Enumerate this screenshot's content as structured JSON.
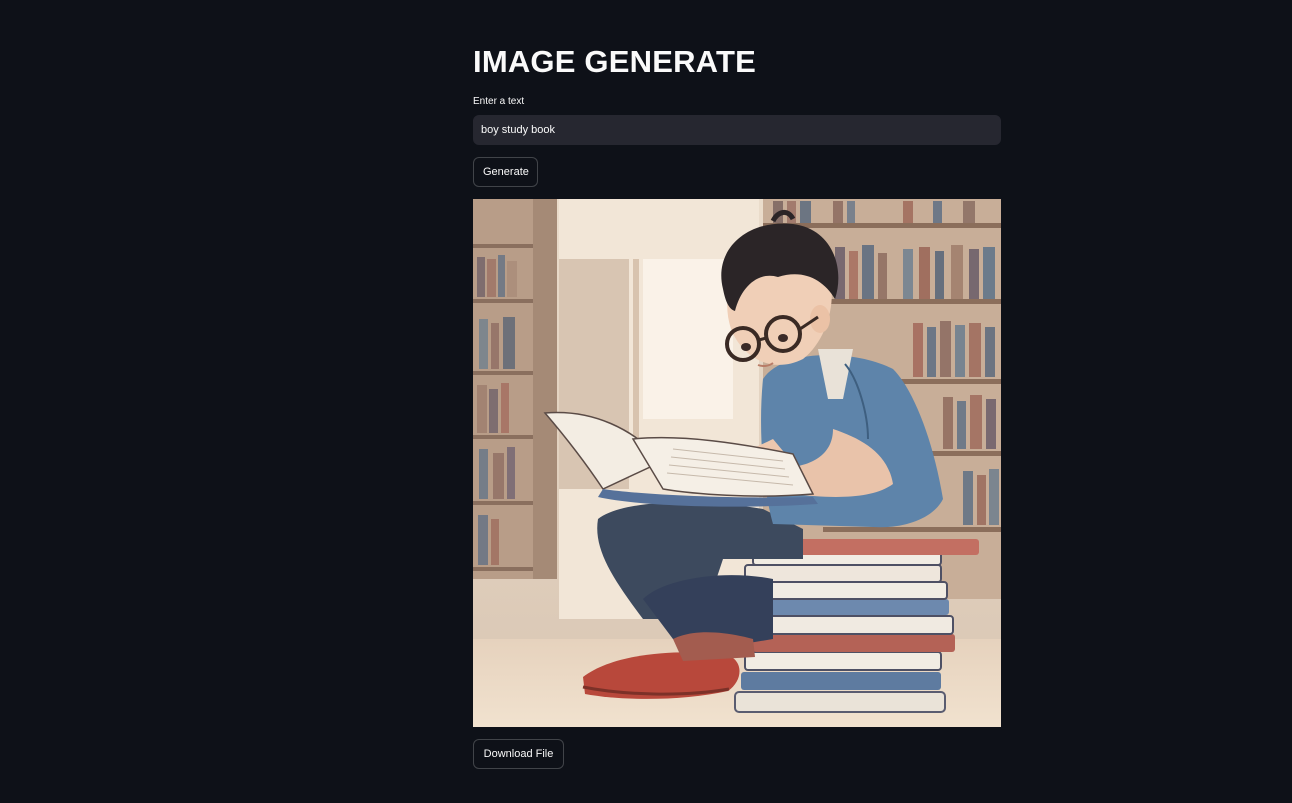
{
  "page": {
    "title": "IMAGE GENERATE"
  },
  "prompt_input": {
    "label": "Enter a text",
    "value": "boy study book"
  },
  "buttons": {
    "generate_label": "Generate",
    "download_label": "Download File"
  },
  "generated_image": {
    "description_icon": "generated-illustration"
  },
  "colors": {
    "background": "#0e1118",
    "input_bg": "#262730",
    "text": "#fafafa"
  }
}
